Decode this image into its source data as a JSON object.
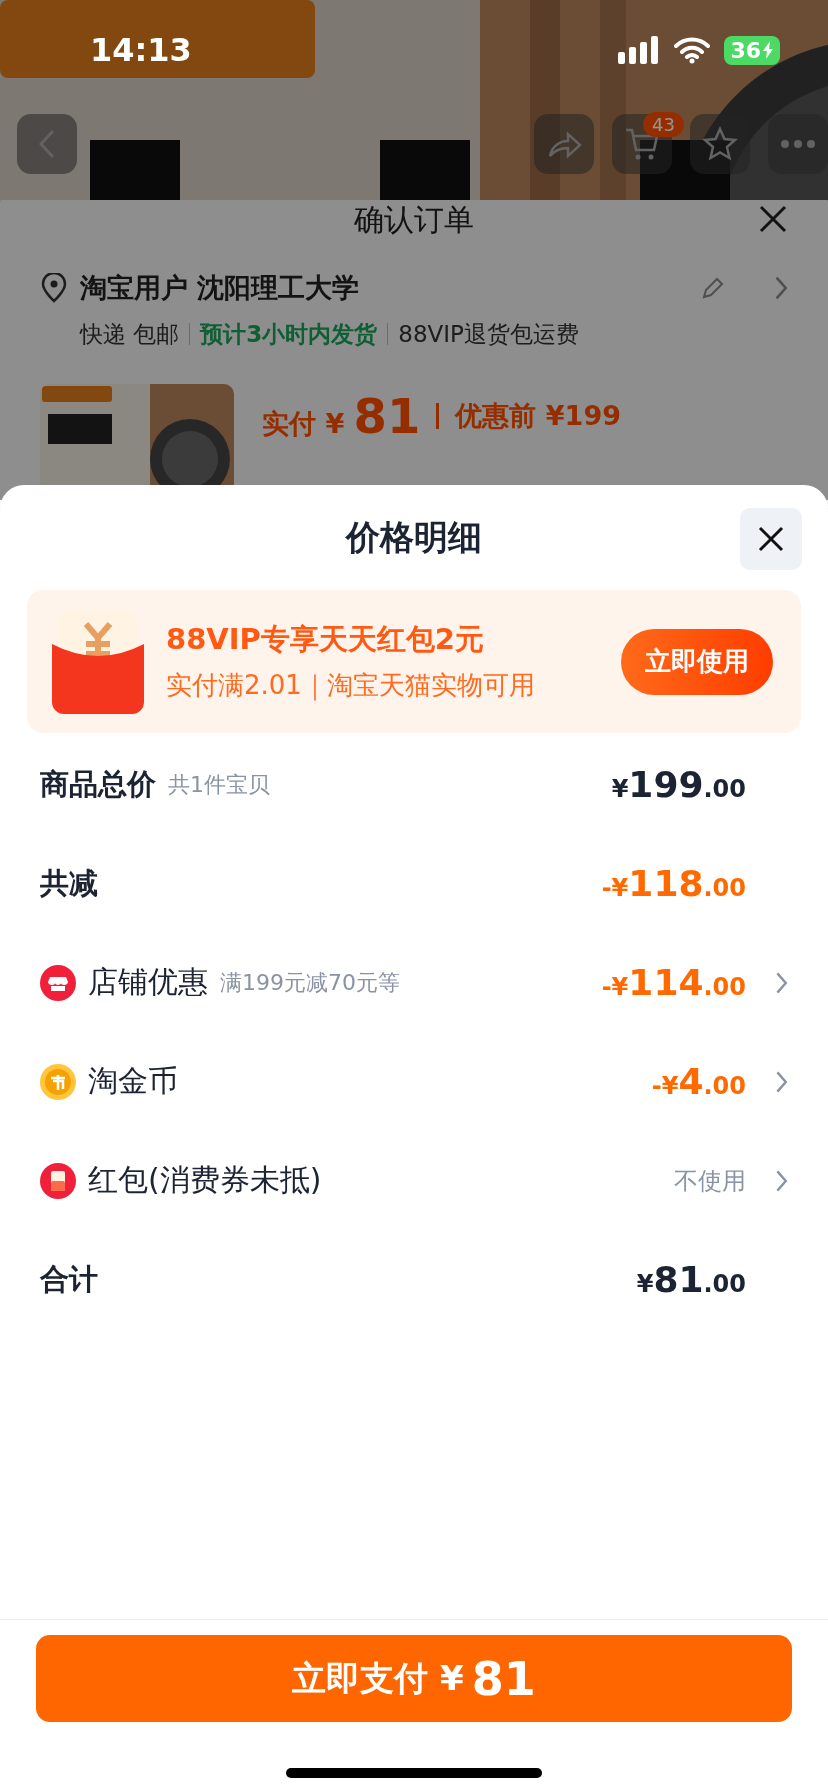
{
  "status_bar": {
    "time": "14:13",
    "battery": "36"
  },
  "nav": {
    "cart_badge": "43"
  },
  "order_sheet": {
    "title": "确认订单",
    "address": "淘宝用户 沈阳理工大学",
    "shipping": [
      {
        "text": "快递 包邮",
        "kind": "plain"
      },
      {
        "text": "预计3小时内发货",
        "kind": "highlight"
      },
      {
        "text": "88VIP退货包运费",
        "kind": "plain"
      }
    ],
    "product": {
      "paid_label": "实付",
      "currency": "¥",
      "paid": "81",
      "before": "优惠前 ¥199"
    }
  },
  "price_sheet": {
    "title": "价格明细",
    "promo": {
      "title": "88VIP专享天天红包2元",
      "subtitle": "实付满2.01｜淘宝天猫实物可用",
      "button": "立即使用"
    },
    "rows": [
      {
        "kind": "subtotal",
        "label": "商品总价",
        "note": "共1件宝贝",
        "prefix": "¥",
        "integer": "199",
        "decimals": ".00"
      },
      {
        "kind": "savings",
        "label": "共减",
        "prefix": "-¥",
        "integer": "118",
        "decimals": ".00"
      },
      {
        "kind": "store",
        "label": "店铺优惠",
        "note": "满199元减70元等",
        "prefix": "-¥",
        "integer": "114",
        "decimals": ".00"
      },
      {
        "kind": "coin",
        "label": "淘金币",
        "prefix": "-¥",
        "integer": "4",
        "decimals": ".00"
      },
      {
        "kind": "packet",
        "label": "红包(消费券未抵)",
        "value": "不使用"
      },
      {
        "kind": "total",
        "label": "合计",
        "prefix": "¥",
        "integer": "81",
        "decimals": ".00"
      }
    ],
    "pay_button": {
      "label": "立即支付",
      "currency": "¥",
      "amount": "81"
    }
  }
}
